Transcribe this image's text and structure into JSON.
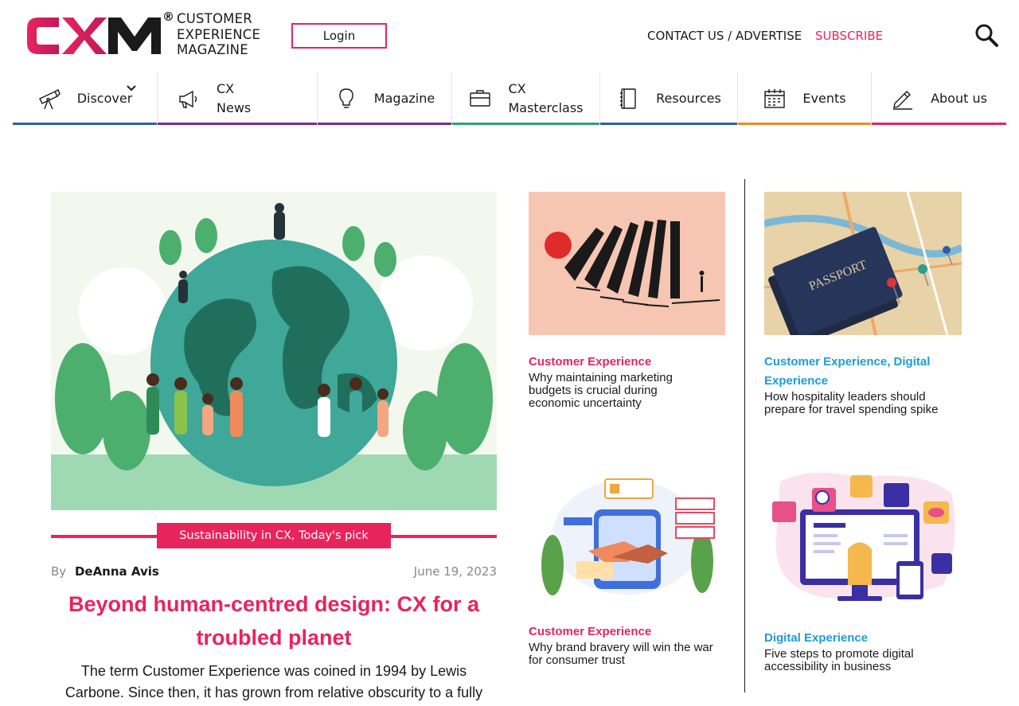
{
  "header": {
    "logo_mark": "CXM",
    "logo_registered": "®",
    "logo_lines": [
      "CUSTOMER",
      "EXPERIENCE",
      "MAGAZINE"
    ],
    "login_label": "Login",
    "contact_label": "CONTACT US / ADVERTISE",
    "subscribe_label": "SUBSCRIBE"
  },
  "nav": {
    "items": [
      {
        "label": "Discover",
        "icon": "telescope-icon",
        "color": "#2b5fa8",
        "has_dropdown": true
      },
      {
        "label_line1": "CX",
        "label_line2": "News",
        "icon": "megaphone-icon",
        "color": "#7b2a8c"
      },
      {
        "label": "Magazine",
        "icon": "lightbulb-icon",
        "color": "#7b2a8c"
      },
      {
        "label_line1": "CX",
        "label_line2": "Masterclass",
        "icon": "briefcase-icon",
        "color": "#2ea36b"
      },
      {
        "label": "Resources",
        "icon": "notebook-icon",
        "color": "#2b5fa8"
      },
      {
        "label": "Events",
        "icon": "calendar-icon",
        "color": "#f08a24"
      },
      {
        "label": "About us",
        "icon": "pencil-icon",
        "color": "#e8245d"
      }
    ]
  },
  "feature": {
    "category": "Sustainability in CX, Today's pick",
    "by_label": "By",
    "author": "DeAnna Avis",
    "date": "June 19, 2023",
    "headline_line1": "Beyond human-centred design: CX for a",
    "headline_line2": "troubled planet",
    "excerpt_line1": "The term Customer Experience was coined in 1994 by Lewis",
    "excerpt_line2": "Carbone. Since then, it has grown from relative obscurity to a fully",
    "image": "earth-people-illustration"
  },
  "cards": [
    {
      "category": "Customer Experience",
      "title_lines": [
        "Why maintaining marketing",
        "budgets is crucial during",
        "economic uncertainty"
      ],
      "image": "dominoes-illustration"
    },
    {
      "category_line1": "Customer Experience, Digital",
      "category_line2": "Experience",
      "title_lines": [
        "How hospitality leaders should",
        "prepare for travel spending spike"
      ],
      "image": "passport-map-photo"
    },
    {
      "category": "Customer Experience",
      "title_lines": [
        "Why brand bravery will win the war",
        "for consumer trust"
      ],
      "image": "handshake-illustration"
    },
    {
      "category": "Digital Experience",
      "title_lines": [
        "Five steps to promote digital",
        "accessibility in business"
      ],
      "image": "accessibility-illustration"
    }
  ],
  "colors": {
    "brand_pink": "#e8245d",
    "category_blue": "#1e9bd7"
  }
}
